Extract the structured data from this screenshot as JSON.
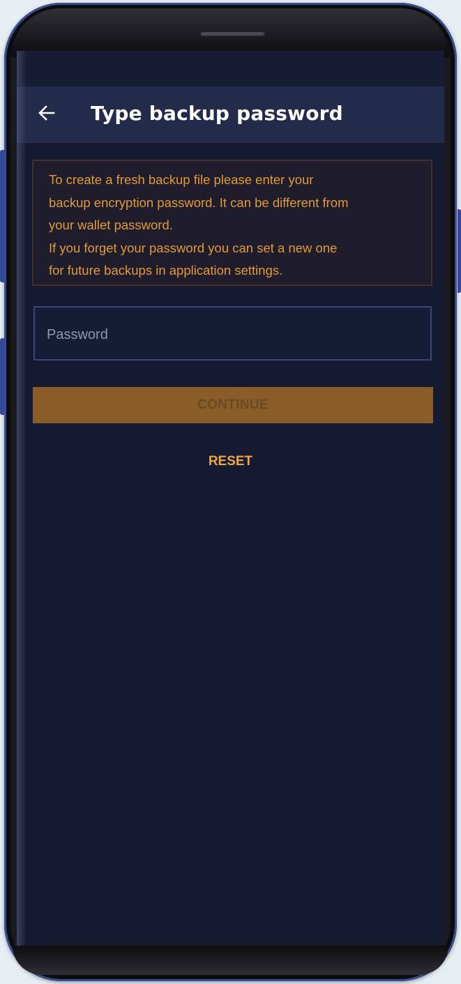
{
  "app_bar": {
    "back_icon": "arrow-left-icon",
    "title": "Type backup password"
  },
  "info": {
    "lines": [
      "To create a fresh backup file please enter your",
      "backup encryption password. It can be different from",
      "your wallet password.",
      "If you forget your password you can set a new one",
      "for future backups in application settings."
    ]
  },
  "form": {
    "password_placeholder": "Password",
    "password_value": ""
  },
  "actions": {
    "continue_label": "CONTINUE",
    "reset_label": "RESET"
  },
  "colors": {
    "background": "#161a30",
    "app_bar": "#232b4b",
    "accent": "#f0a544",
    "continue_button": "#8a5c28",
    "info_text": "#e09a3a"
  }
}
